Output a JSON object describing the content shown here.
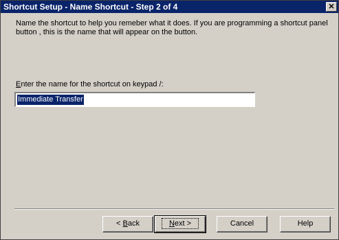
{
  "window": {
    "title": "Shortcut Setup - Name Shortcut - Step 2 of 4",
    "close_glyph": "✕"
  },
  "main": {
    "description": "Name the shortcut to help you remeber what it does.  If you are programming a shortcut panel button , this is the name that will appear on the button.",
    "prompt_mnemonic": "E",
    "prompt_rest": "nter the name for the shortcut on keypad /:",
    "name_value": "Immediate Transfer"
  },
  "buttons": {
    "back_prefix": "< ",
    "back_mnemonic": "B",
    "back_rest": "ack",
    "next_mnemonic": "N",
    "next_rest": "ext >",
    "cancel": "Cancel",
    "help": "Help"
  }
}
